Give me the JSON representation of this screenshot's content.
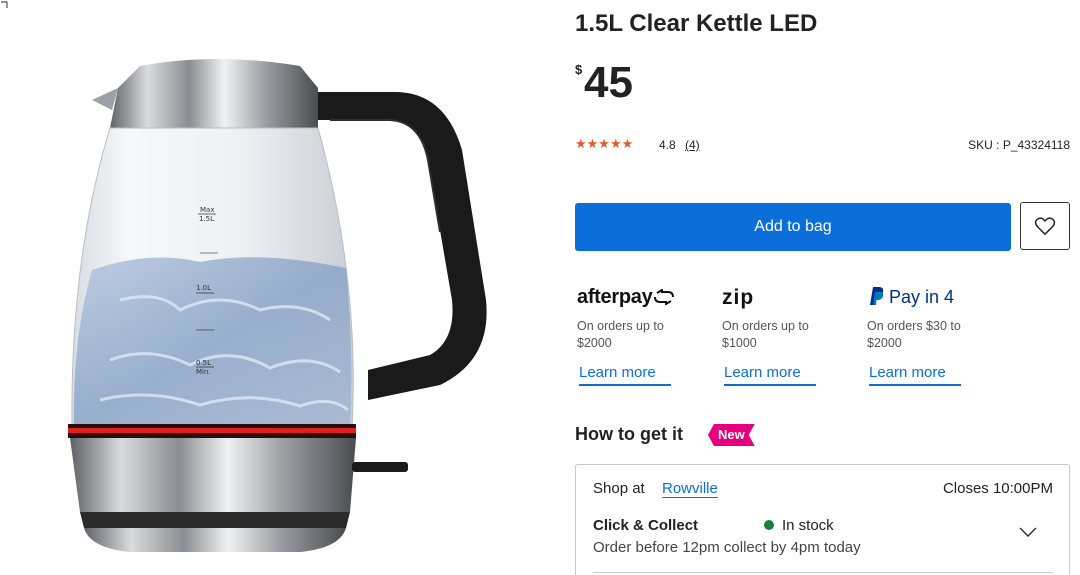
{
  "product": {
    "title": "1.5L Clear Kettle LED",
    "currency": "$",
    "price": "45",
    "rating": "4.8",
    "review_count": "(4)",
    "sku": "SKU : P_43324118",
    "stars": 5
  },
  "actions": {
    "add_to_bag": "Add to bag"
  },
  "payments": [
    {
      "brand": "afterpay",
      "desc": "On orders up to $2000",
      "learn": "Learn more"
    },
    {
      "brand": "zip",
      "desc": "On orders up to $1000",
      "learn": "Learn more"
    },
    {
      "brand": "Pay in 4",
      "desc": "On orders $30 to $2000",
      "learn": "Learn more"
    }
  ],
  "fulfilment": {
    "heading": "How to get it",
    "badge": "New",
    "shop_at": "Shop at",
    "store": "Rowville",
    "closes": "Closes 10:00PM",
    "method": "Click & Collect",
    "stock": "In stock",
    "note": "Order before 12pm collect by 4pm today"
  },
  "kettle_markings": {
    "max": "Max",
    "max_vol": "1.5L",
    "mid": "1.0L",
    "min_vol": "0.5L",
    "min": "Min."
  },
  "colors": {
    "primary_blue": "#0c6fd9",
    "star_orange": "#e8592a",
    "badge_pink": "#e6007e",
    "stock_green": "#1b7f3a",
    "led_red": "#e0201a"
  },
  "icons": {
    "wishlist": "heart-icon",
    "expand": "chevron-down-icon",
    "in_stock": "dot-icon"
  }
}
